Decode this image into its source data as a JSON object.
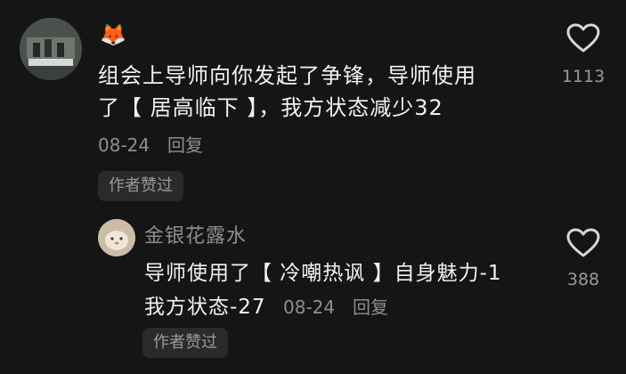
{
  "comment": {
    "author_emoji": "🦊",
    "text_line1": "组会上导师向你发起了争锋，导师使用",
    "text_line2": "了【 居高临下 】，我方状态减少32",
    "date": "08-24",
    "reply_label": "回复",
    "author_liked_tag": "作者赞过",
    "like_count": "1113"
  },
  "reply": {
    "author_name": "金银花露水",
    "text_line1": "导师使用了【 冷嘲热讽 】自身魅力-1",
    "text_line2": "我方状态-27",
    "date": "08-24",
    "reply_label": "回复",
    "author_liked_tag": "作者赞过",
    "like_count": "388"
  },
  "colors": {
    "background": "#151515",
    "primary_text": "#f2f2f2",
    "secondary_text": "#8e8e8e",
    "tag_bg": "#2a2a2a"
  }
}
